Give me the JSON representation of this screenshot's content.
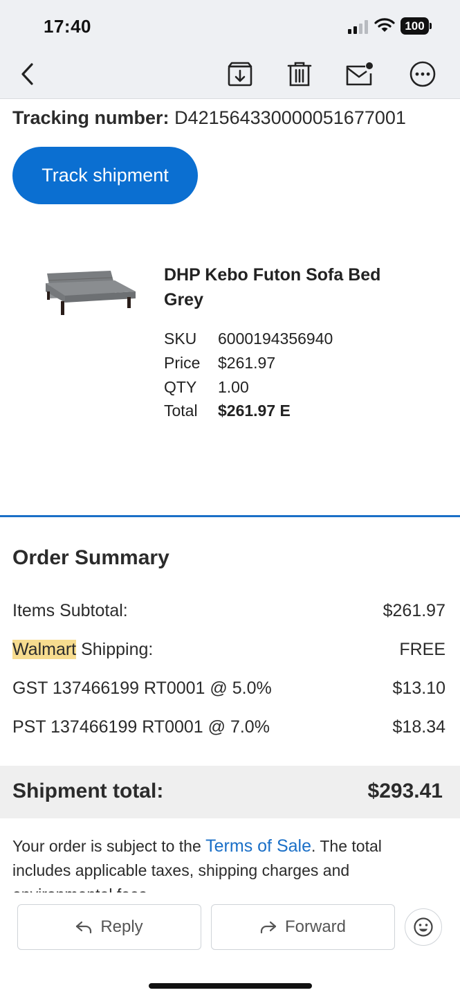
{
  "status_bar": {
    "time": "17:40",
    "battery": "100",
    "icons": [
      "signal-icon",
      "wifi-icon",
      "battery-icon"
    ]
  },
  "toolbar": {
    "icons": [
      "back-icon",
      "archive-icon",
      "trash-icon",
      "mark-unread-icon",
      "more-icon"
    ]
  },
  "tracking": {
    "label": "Tracking number:",
    "number": "D421564330000051677001",
    "button_label": "Track shipment"
  },
  "product": {
    "name": "DHP Kebo Futon Sofa Bed Grey",
    "image_icon": "sofa-image",
    "specs": [
      {
        "label": "SKU",
        "value": "6000194356940"
      },
      {
        "label": "Price",
        "value": "$261.97"
      },
      {
        "label": "QTY",
        "value": "1.00"
      },
      {
        "label": "Total",
        "value": "$261.97 E"
      }
    ]
  },
  "summary": {
    "title": "Order Summary",
    "items_subtotal_label": "Items Subtotal:",
    "items_subtotal_value": "$261.97",
    "shipping_highlight": "Walmart",
    "shipping_label_rest": " Shipping:",
    "shipping_value": "FREE",
    "gst_label": "GST 137466199 RT0001 @ 5.0%",
    "gst_value": "$13.10",
    "pst_label": "PST 137466199 RT0001 @ 7.0%",
    "pst_value": "$18.34",
    "shipment_total_label": "Shipment total:",
    "shipment_total_value": "$293.41"
  },
  "legal": {
    "prefix": "Your order is subject to the ",
    "link": "Terms of Sale",
    "suffix": ". The total includes applicable taxes, shipping charges and environmental fees"
  },
  "actions": {
    "reply_label": "Reply",
    "forward_label": "Forward",
    "emoji_icon": "emoji-reaction-icon"
  },
  "colors": {
    "accent": "#0b6fd1",
    "link": "#1a6fc7",
    "highlight": "#f7dc8f",
    "toolbar_bg": "#eef0f3"
  }
}
